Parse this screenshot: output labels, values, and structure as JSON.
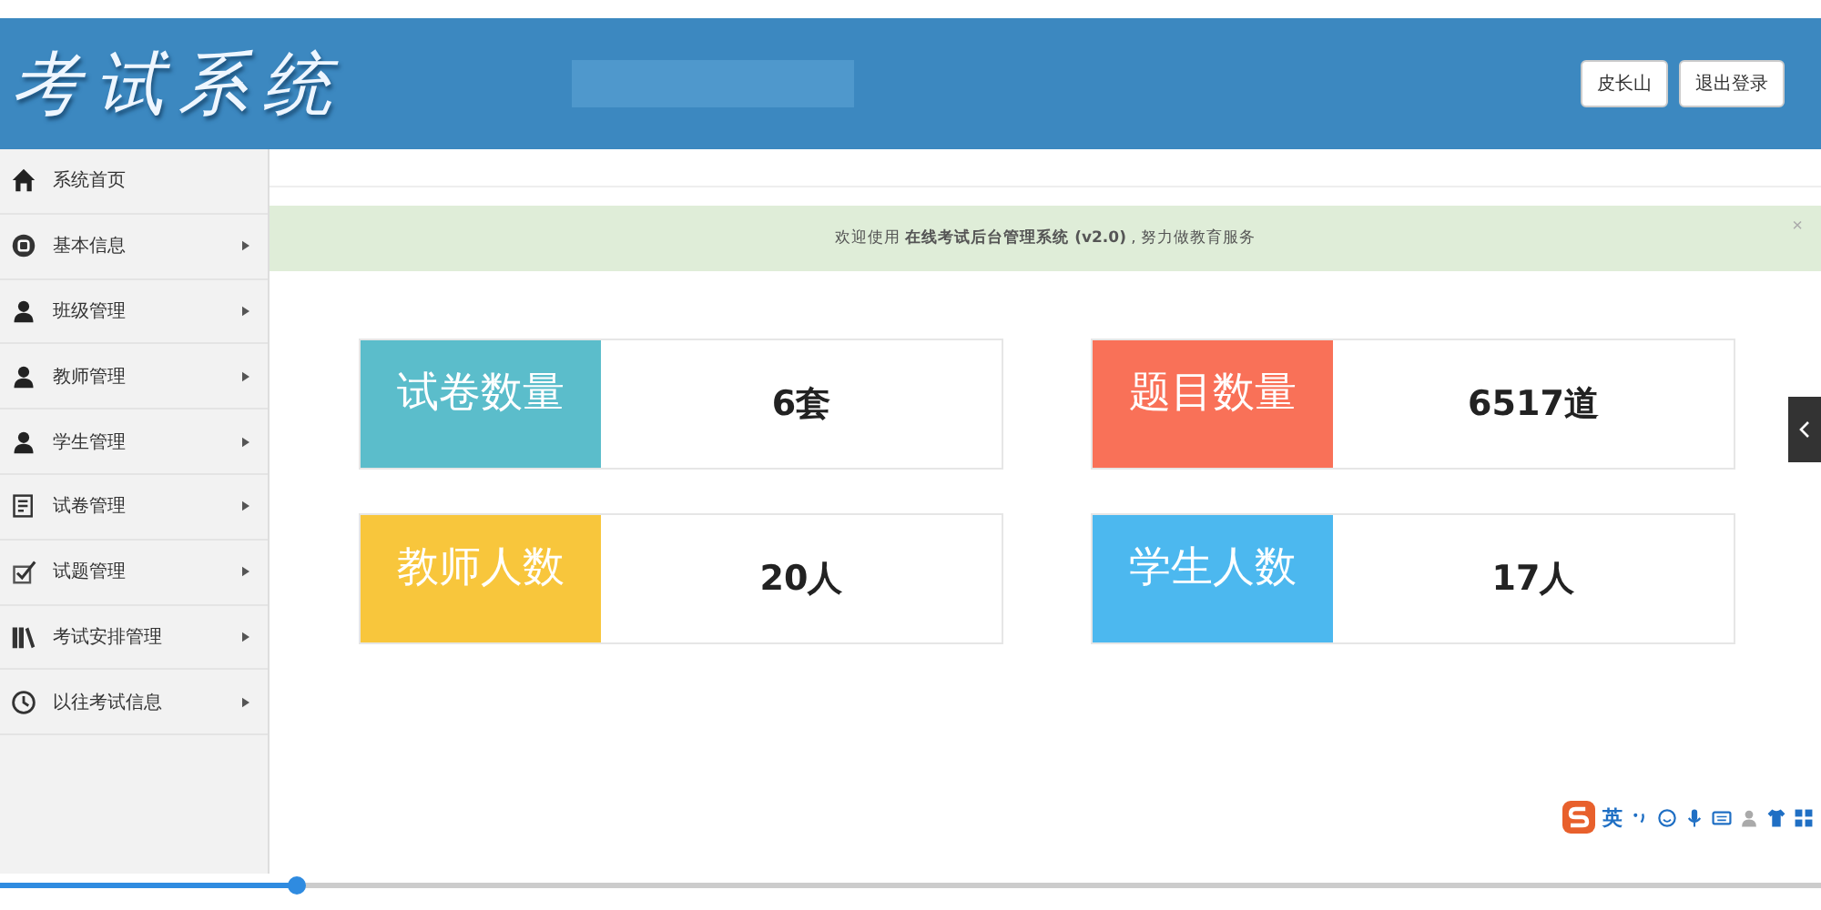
{
  "header": {
    "logo": "考试系统",
    "buttons": [
      "皮长山",
      "退出登录"
    ]
  },
  "sidebar": {
    "items": [
      {
        "label": "系统首页",
        "has_submenu": false
      },
      {
        "label": "基本信息",
        "has_submenu": true
      },
      {
        "label": "班级管理",
        "has_submenu": true
      },
      {
        "label": "教师管理",
        "has_submenu": true
      },
      {
        "label": "学生管理",
        "has_submenu": true
      },
      {
        "label": "试卷管理",
        "has_submenu": true
      },
      {
        "label": "试题管理",
        "has_submenu": true
      },
      {
        "label": "考试安排管理",
        "has_submenu": true
      },
      {
        "label": "以往考试信息",
        "has_submenu": true
      }
    ]
  },
  "alert": {
    "text": "欢迎使用 **在线考试后台管理系统 (v2.0)** , 努力做教育服务",
    "close": "×"
  },
  "stats": [
    {
      "label": "试卷数量",
      "value": "6套",
      "color": "#5bbdcb"
    },
    {
      "label": "题目数量",
      "value": "6517道",
      "color": "#f97158"
    },
    {
      "label": "教师人数",
      "value": "20人",
      "color": "#f8c63c"
    },
    {
      "label": "学生人数",
      "value": "17人",
      "color": "#4cb8ef"
    }
  ],
  "ime_toolbar": {
    "language": "英"
  }
}
